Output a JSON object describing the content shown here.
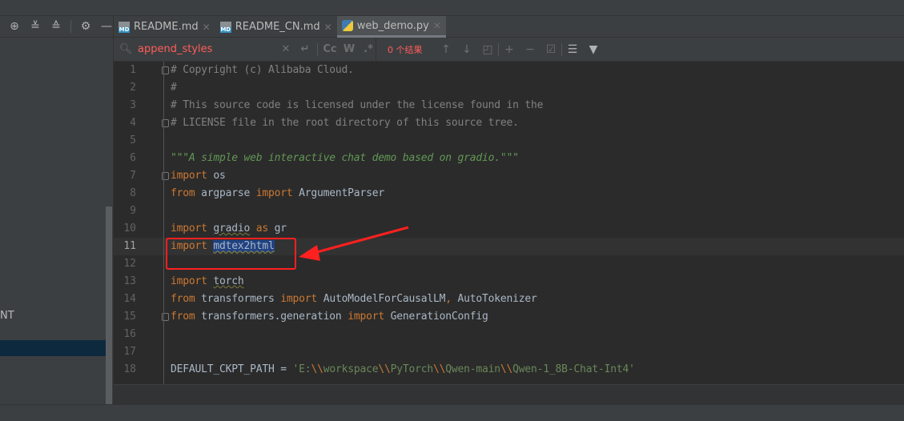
{
  "left_toolbar": {
    "icons": [
      "locate-icon",
      "expand-all-icon",
      "collapse-all-icon",
      "gear-icon",
      "minimize-icon"
    ]
  },
  "left_panel": {
    "partial_text": "NT"
  },
  "tabs": [
    {
      "label": "README.md",
      "icon": "markdown-file-icon",
      "active": false
    },
    {
      "label": "README_CN.md",
      "icon": "markdown-file-icon",
      "active": false
    },
    {
      "label": "web_demo.py",
      "icon": "python-file-icon",
      "active": true
    }
  ],
  "tab_icon_text": "MD",
  "search": {
    "query": "append_styles",
    "result": "0 个结果",
    "options": [
      "Cc",
      "W",
      ".*"
    ]
  },
  "colors": {
    "keyword": "#cc7832",
    "comment": "#808080",
    "docstring": "#629755",
    "string": "#6a8759",
    "text": "#a9b7c6",
    "annotation": "#ff2020"
  },
  "current_line": 11,
  "lines": [
    {
      "n": "1",
      "fold": true,
      "tokens": [
        {
          "c": "cm",
          "t": "# Copyright (c) Alibaba Cloud."
        }
      ]
    },
    {
      "n": "2",
      "tokens": [
        {
          "c": "cm",
          "t": "#"
        }
      ]
    },
    {
      "n": "3",
      "tokens": [
        {
          "c": "cm",
          "t": "# This source code is licensed under the license found in the"
        }
      ]
    },
    {
      "n": "4",
      "fold": true,
      "tokens": [
        {
          "c": "cm",
          "t": "# LICENSE file in the root directory of this source tree."
        }
      ]
    },
    {
      "n": "5",
      "tokens": []
    },
    {
      "n": "6",
      "tokens": [
        {
          "c": "doc",
          "t": "\"\"\"A simple web interactive chat demo based on gradio.\"\"\""
        }
      ]
    },
    {
      "n": "7",
      "fold": true,
      "tokens": [
        {
          "c": "kw",
          "t": "import "
        },
        {
          "c": "pl",
          "t": "os"
        }
      ]
    },
    {
      "n": "8",
      "tokens": [
        {
          "c": "kw",
          "t": "from "
        },
        {
          "c": "pl",
          "t": "argparse "
        },
        {
          "c": "kw",
          "t": "import "
        },
        {
          "c": "pl",
          "t": "ArgumentParser"
        }
      ]
    },
    {
      "n": "9",
      "tokens": []
    },
    {
      "n": "10",
      "tokens": [
        {
          "c": "kw",
          "t": "import "
        },
        {
          "c": "ul",
          "t": "gradio"
        },
        {
          "c": "kw",
          "t": " as "
        },
        {
          "c": "pl",
          "t": "gr"
        }
      ]
    },
    {
      "n": "11",
      "tokens": [
        {
          "c": "kw",
          "t": "import "
        },
        {
          "c": "sel",
          "t": "mdtex2html"
        }
      ]
    },
    {
      "n": "12",
      "tokens": []
    },
    {
      "n": "13",
      "tokens": [
        {
          "c": "kw",
          "t": "import "
        },
        {
          "c": "ul",
          "t": "torch"
        }
      ]
    },
    {
      "n": "14",
      "tokens": [
        {
          "c": "kw",
          "t": "from "
        },
        {
          "c": "pl",
          "t": "transformers "
        },
        {
          "c": "kw",
          "t": "import "
        },
        {
          "c": "pl",
          "t": "AutoModelForCausalLM"
        },
        {
          "c": "kw",
          "t": ", "
        },
        {
          "c": "pl",
          "t": "AutoTokenizer"
        }
      ]
    },
    {
      "n": "15",
      "fold": true,
      "tokens": [
        {
          "c": "kw",
          "t": "from "
        },
        {
          "c": "pl",
          "t": "transformers.generation "
        },
        {
          "c": "kw",
          "t": "import "
        },
        {
          "c": "pl",
          "t": "GenerationConfig"
        }
      ]
    },
    {
      "n": "16",
      "tokens": []
    },
    {
      "n": "17",
      "tokens": []
    },
    {
      "n": "18",
      "tokens": [
        {
          "c": "pl",
          "t": "DEFAULT_CKPT_PATH = "
        },
        {
          "c": "str",
          "t": "'E:"
        },
        {
          "c": "esc",
          "t": "\\\\"
        },
        {
          "c": "str",
          "t": "workspace"
        },
        {
          "c": "esc",
          "t": "\\\\"
        },
        {
          "c": "str",
          "t": "PyTorch"
        },
        {
          "c": "esc",
          "t": "\\\\"
        },
        {
          "c": "str",
          "t": "Qwen-main"
        },
        {
          "c": "esc",
          "t": "\\\\"
        },
        {
          "c": "str",
          "t": "Qwen-1_8B-Chat-Int4'"
        }
      ]
    }
  ]
}
